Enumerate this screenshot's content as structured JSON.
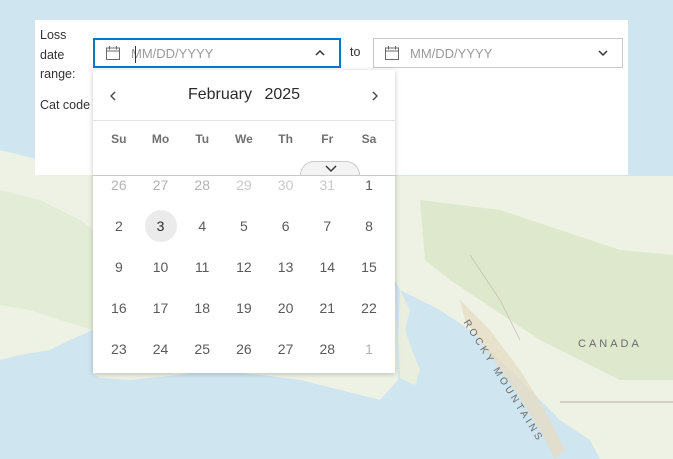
{
  "map": {
    "labels": [
      "CANADA",
      "ROCKY MOUNTAINS"
    ]
  },
  "filter": {
    "loss_label": "Loss\ndate\nrange:",
    "to_label": "to",
    "cat_label": "Cat code",
    "start_input": {
      "placeholder": "MM/DD/YYYY",
      "value": ""
    },
    "end_input": {
      "placeholder": "MM/DD/YYYY",
      "value": ""
    }
  },
  "calendar": {
    "month": "February",
    "year": "2025",
    "weekdays": [
      "Su",
      "Mo",
      "Tu",
      "We",
      "Th",
      "Fr",
      "Sa"
    ],
    "weeks": [
      [
        {
          "d": "26",
          "m": true
        },
        {
          "d": "27",
          "m": true
        },
        {
          "d": "28",
          "m": true
        },
        {
          "d": "29",
          "m": true
        },
        {
          "d": "30",
          "m": true
        },
        {
          "d": "31",
          "m": true
        },
        {
          "d": "1"
        }
      ],
      [
        {
          "d": "2"
        },
        {
          "d": "3",
          "today": true
        },
        {
          "d": "4"
        },
        {
          "d": "5"
        },
        {
          "d": "6"
        },
        {
          "d": "7"
        },
        {
          "d": "8"
        }
      ],
      [
        {
          "d": "9"
        },
        {
          "d": "10"
        },
        {
          "d": "11"
        },
        {
          "d": "12"
        },
        {
          "d": "13"
        },
        {
          "d": "14"
        },
        {
          "d": "15"
        }
      ],
      [
        {
          "d": "16"
        },
        {
          "d": "17"
        },
        {
          "d": "18"
        },
        {
          "d": "19"
        },
        {
          "d": "20"
        },
        {
          "d": "21"
        },
        {
          "d": "22"
        }
      ],
      [
        {
          "d": "23"
        },
        {
          "d": "24"
        },
        {
          "d": "25"
        },
        {
          "d": "26"
        },
        {
          "d": "27"
        },
        {
          "d": "28"
        },
        {
          "d": "1",
          "m": true
        }
      ]
    ]
  },
  "colors": {
    "accent": "#007ac2",
    "water": "#cfe5ef",
    "land": "#eef2e4"
  }
}
